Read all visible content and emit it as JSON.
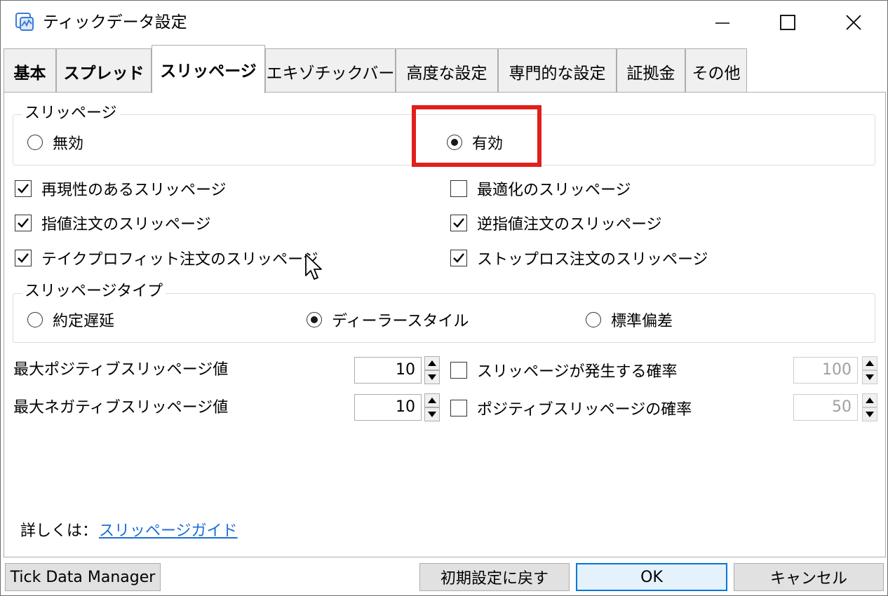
{
  "window": {
    "title": "ティックデータ設定",
    "controls": {
      "minimize": "minimize-icon",
      "maximize": "maximize-icon",
      "close": "close-icon"
    }
  },
  "tabs": [
    {
      "label": "基本"
    },
    {
      "label": "スプレッド"
    },
    {
      "label": "スリッページ",
      "active": true
    },
    {
      "label": "エキゾチックバー"
    },
    {
      "label": "高度な設定"
    },
    {
      "label": "専門的な設定"
    },
    {
      "label": "証拠金"
    },
    {
      "label": "その他"
    }
  ],
  "slippage_group": {
    "legend": "スリッページ",
    "disabled_label": "無効",
    "enabled_label": "有効",
    "selected": "有効"
  },
  "checkboxes": {
    "reproducible": {
      "label": "再現性のあるスリッページ",
      "checked": true
    },
    "optimization": {
      "label": "最適化のスリッページ",
      "checked": false
    },
    "limit": {
      "label": "指値注文のスリッページ",
      "checked": true
    },
    "stop": {
      "label": "逆指値注文のスリッページ",
      "checked": true
    },
    "take_profit": {
      "label": "テイクプロフィット注文のスリッページ",
      "checked": true
    },
    "stop_loss": {
      "label": "ストップロス注文のスリッページ",
      "checked": true
    }
  },
  "type_group": {
    "legend": "スリッページタイプ",
    "delay_label": "約定遅延",
    "dealer_label": "ディーラースタイル",
    "stddev_label": "標準偏差",
    "selected": "ディーラースタイル"
  },
  "numeric": {
    "max_positive_label": "最大ポジティブスリッページ値",
    "max_positive_value": "10",
    "max_negative_label": "最大ネガティブスリッページ値",
    "max_negative_value": "10",
    "probability_label": "スリッページが発生する確率",
    "probability_value": "100",
    "probability_checked": false,
    "positive_probability_label": "ポジティブスリッページの確率",
    "positive_probability_value": "50",
    "positive_probability_checked": false
  },
  "footer": {
    "more_label": "詳しくは：",
    "guide_link": "スリッページガイド"
  },
  "buttons": {
    "tick_data_manager": "Tick Data Manager",
    "reset": "初期設定に戻す",
    "ok": "OK",
    "cancel": "キャンセル"
  },
  "colors": {
    "highlight": "#e0201b",
    "link": "#1a6fd6",
    "ok_border": "#0078d7"
  }
}
